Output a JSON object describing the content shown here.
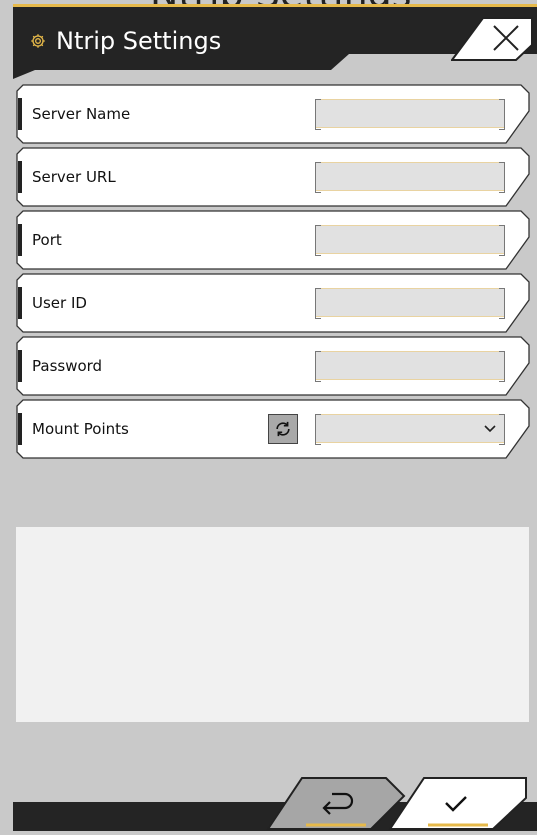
{
  "header": {
    "title": "Ntrip Settings",
    "top_remnant": "Ntrip Settings",
    "icon": "gear-icon",
    "close_icon": "close-icon"
  },
  "form": {
    "server_name": {
      "label": "Server Name",
      "value": ""
    },
    "server_url": {
      "label": "Server URL",
      "value": ""
    },
    "port": {
      "label": "Port",
      "value": ""
    },
    "user_id": {
      "label": "User ID",
      "value": ""
    },
    "password": {
      "label": "Password",
      "value": ""
    },
    "mount_points": {
      "label": "Mount Points",
      "value": "",
      "refresh_icon": "refresh-icon",
      "dropdown_icon": "chevron-down-icon"
    }
  },
  "footer": {
    "back_icon": "return-icon",
    "confirm_icon": "checkmark-icon"
  },
  "colors": {
    "accent": "#e6b94a",
    "header_bg": "#242424",
    "page_bg": "#c9c9c9",
    "row_bg": "#ffffff",
    "field_bg": "#e1e1e1"
  }
}
